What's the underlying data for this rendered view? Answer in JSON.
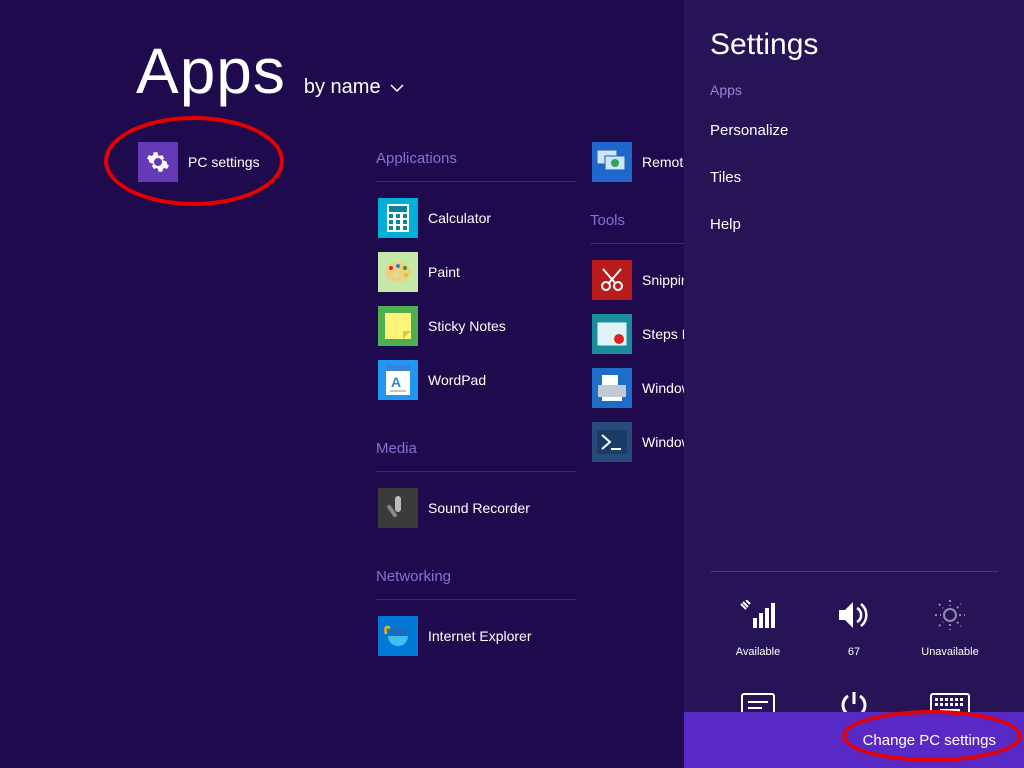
{
  "header": {
    "title": "Apps",
    "sort": "by name"
  },
  "col1": {
    "pc_settings": "PC settings"
  },
  "col2": {
    "g_apps": "Applications",
    "calc": "Calculator",
    "paint": "Paint",
    "sticky": "Sticky Notes",
    "wordpad": "WordPad",
    "g_media": "Media",
    "rec": "Sound Recorder",
    "g_net": "Networking",
    "ie": "Internet Explorer"
  },
  "col3": {
    "rdc": "Remote Desktop Connection",
    "g_tools": "Tools",
    "snip": "Snipping Tool",
    "steps": "Steps Recorder",
    "fax": "Windows Fax and Scan",
    "ps": "Windows PowerShell"
  },
  "charms": {
    "title": "Settings",
    "context": "Apps",
    "personalize": "Personalize",
    "tiles": "Tiles",
    "help": "Help",
    "quick": {
      "network": "Available",
      "volume": "67",
      "brightness": "Unavailable",
      "notifications": "Notifications",
      "power": "Power",
      "keyboard": "Keyboard"
    },
    "change": "Change PC settings"
  }
}
